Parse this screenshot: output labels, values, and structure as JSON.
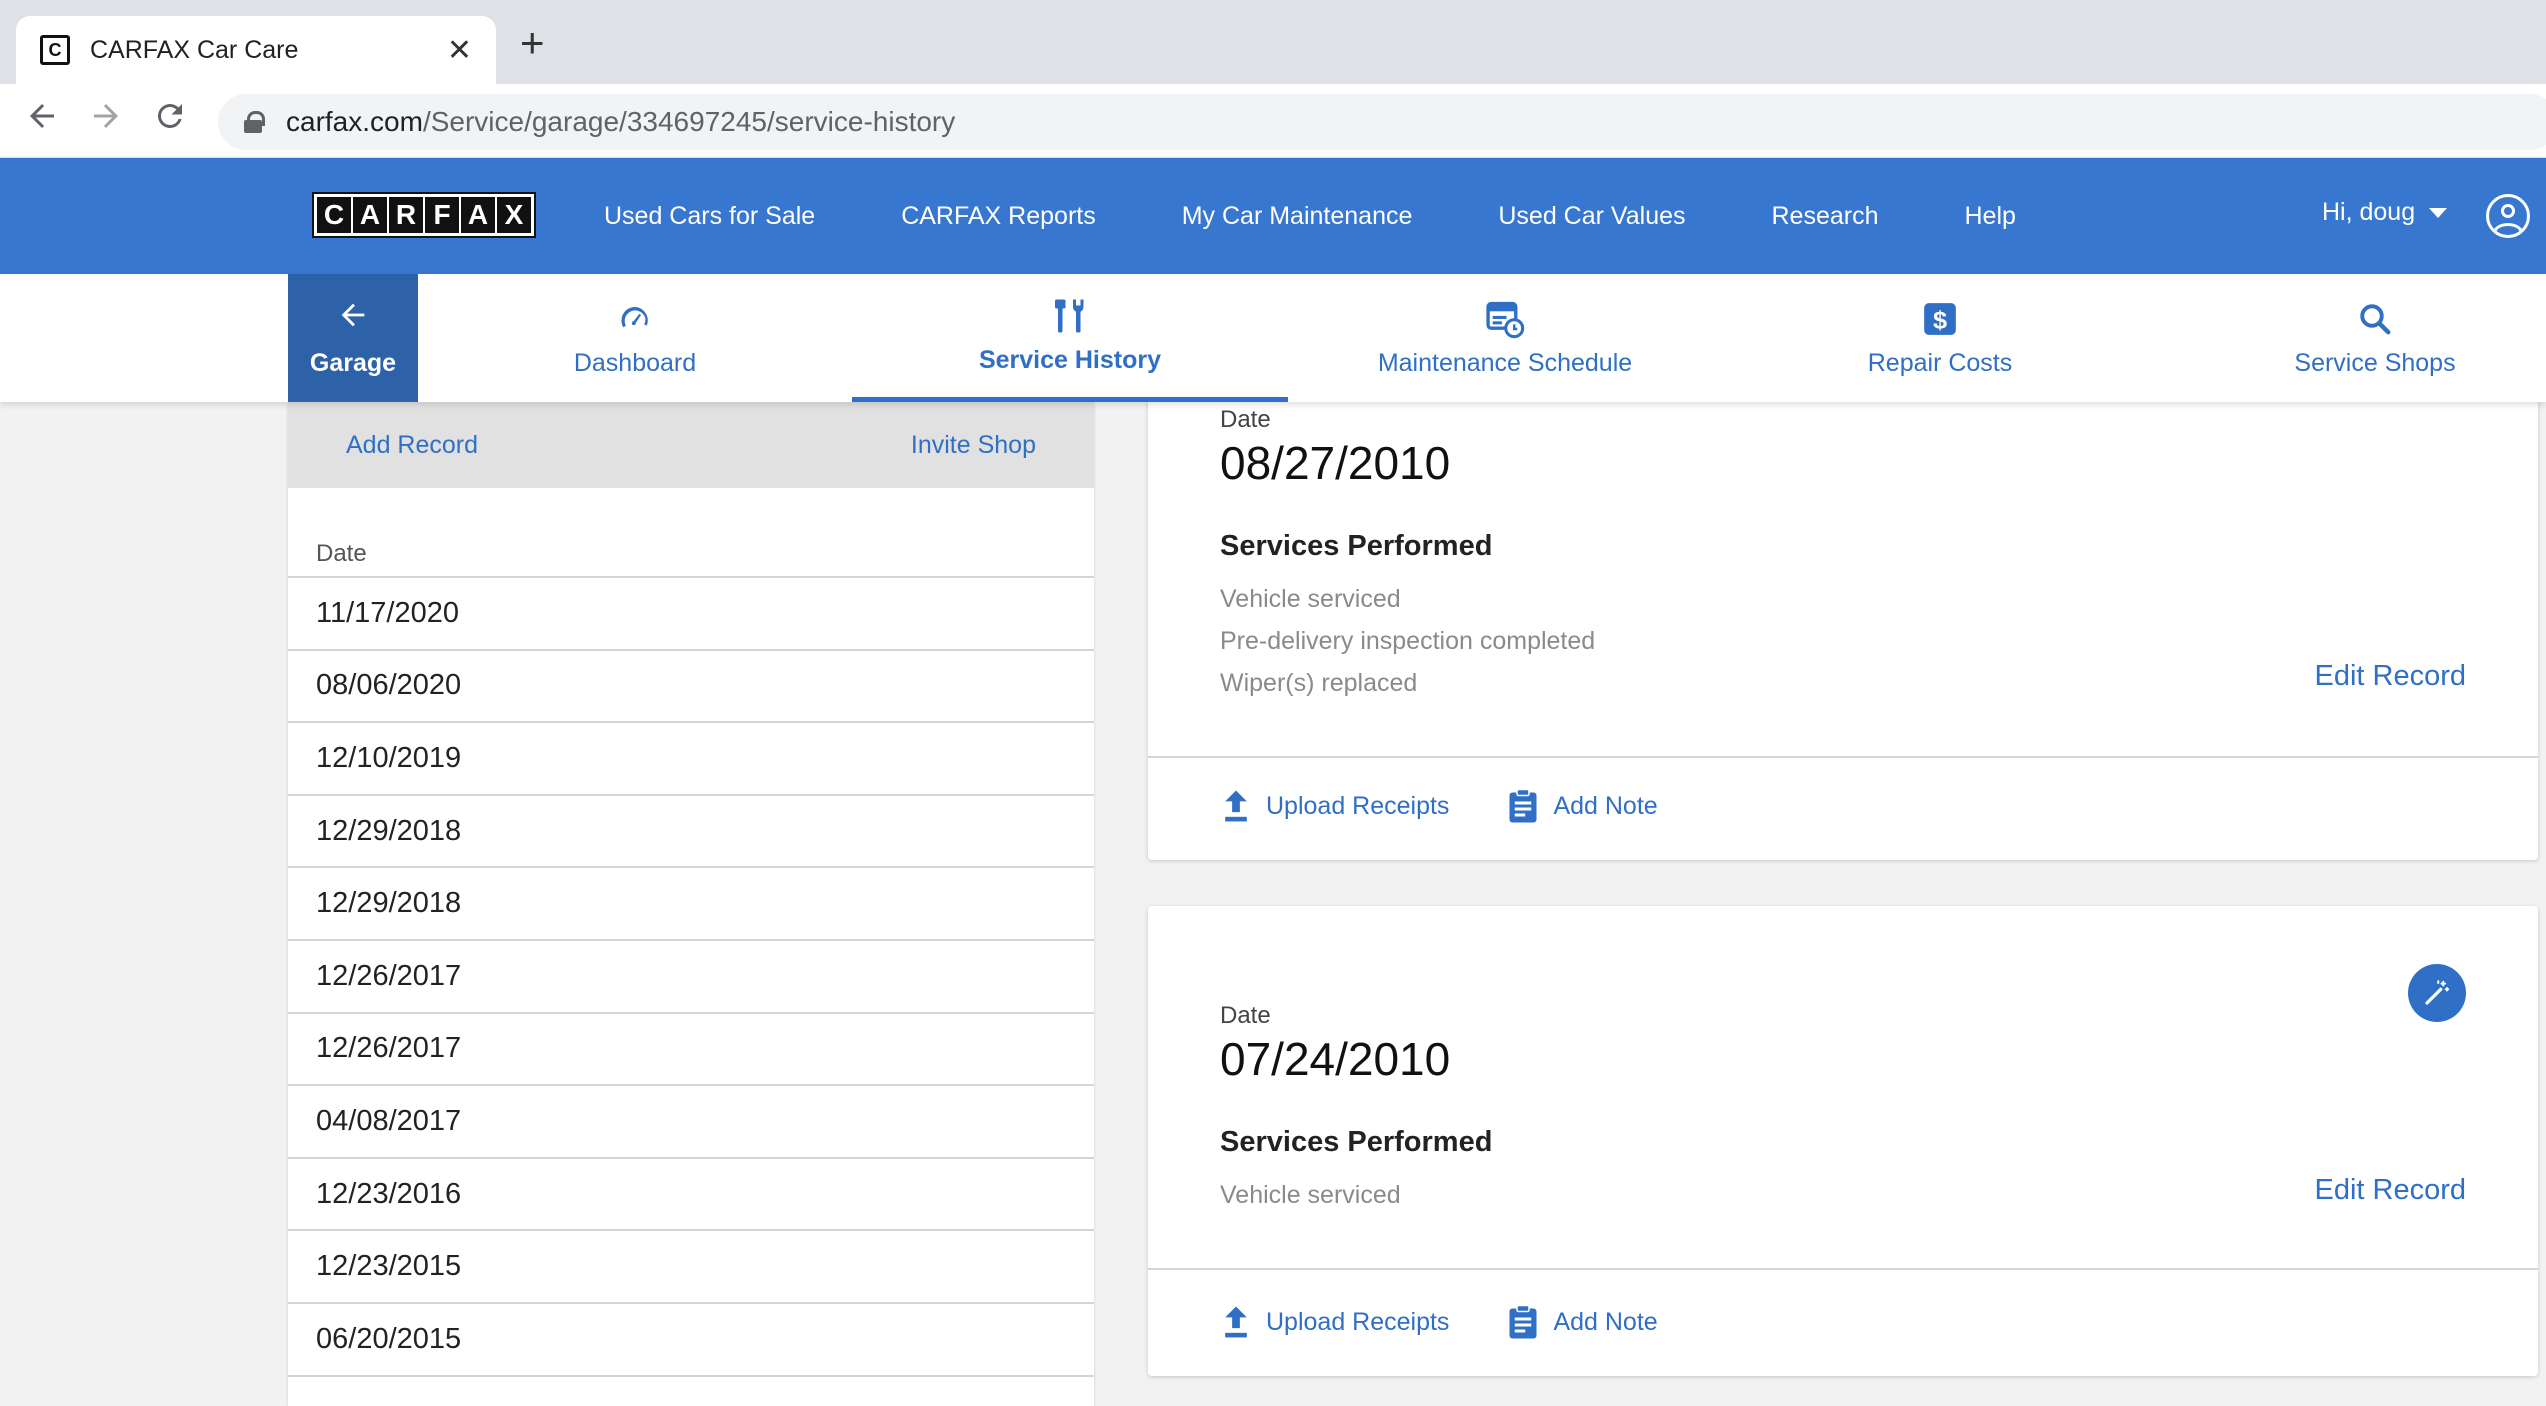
{
  "browser": {
    "tab_title": "CARFAX Car Care",
    "tab_close": "✕",
    "new_tab": "+",
    "url_domain": "carfax.com",
    "url_path": "/Service/garage/334697245/service-history"
  },
  "header": {
    "logo_letters": [
      "C",
      "A",
      "R",
      "F",
      "A",
      "X"
    ],
    "nav": [
      "Used Cars for Sale",
      "CARFAX Reports",
      "My Car Maintenance",
      "Used Car Values",
      "Research",
      "Help"
    ],
    "greeting": "Hi, doug"
  },
  "subnav": {
    "garage": "Garage",
    "items": [
      {
        "label": "Dashboard",
        "icon": "speedometer-icon"
      },
      {
        "label": "Service History",
        "icon": "tools-icon",
        "active": true
      },
      {
        "label": "Maintenance Schedule",
        "icon": "calendar-clock-icon"
      },
      {
        "label": "Repair Costs",
        "icon": "dollar-icon"
      },
      {
        "label": "Service Shops",
        "icon": "search-icon"
      }
    ]
  },
  "left_panel": {
    "add_record": "Add Record",
    "invite_shop": "Invite Shop",
    "date_header": "Date",
    "dates": [
      "11/17/2020",
      "08/06/2020",
      "12/10/2019",
      "12/29/2018",
      "12/29/2018",
      "12/26/2017",
      "12/26/2017",
      "04/08/2017",
      "12/23/2016",
      "12/23/2015",
      "06/20/2015"
    ]
  },
  "cards": [
    {
      "date_label": "Date",
      "date": "08/27/2010",
      "services_title": "Services Performed",
      "services": [
        "Vehicle serviced",
        "Pre-delivery inspection completed",
        "Wiper(s) replaced"
      ],
      "edit": "Edit Record",
      "upload": "Upload Receipts",
      "note": "Add Note"
    },
    {
      "date_label": "Date",
      "date": "07/24/2010",
      "services_title": "Services Performed",
      "services": [
        "Vehicle serviced"
      ],
      "edit": "Edit Record",
      "upload": "Upload Receipts",
      "note": "Add Note"
    }
  ],
  "colors": {
    "brand_blue": "#3777d0",
    "garage_blue": "#2d61a8",
    "link_blue": "#2f6fc6"
  }
}
